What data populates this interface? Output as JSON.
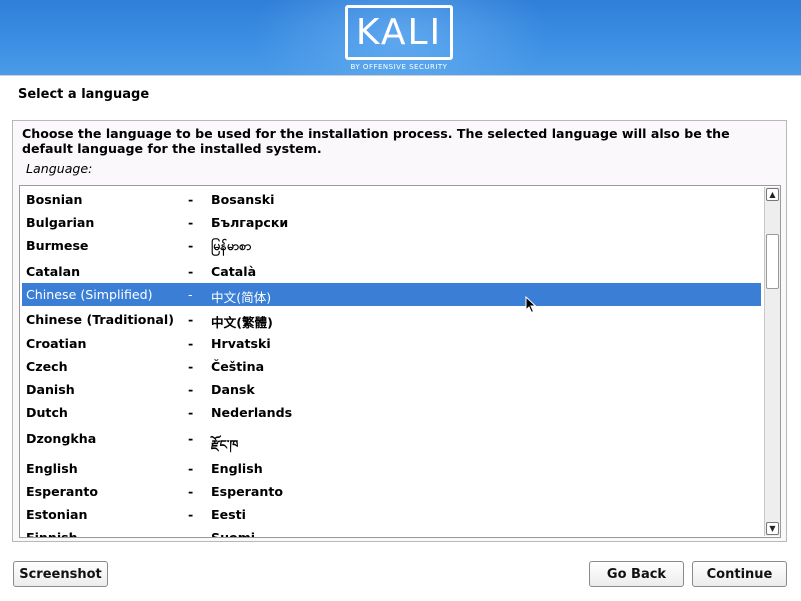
{
  "banner": {
    "logo_text": "KALI",
    "logo_subtitle": "BY OFFENSIVE SECURITY",
    "colors": {
      "top": "#2f7fd8",
      "bottom": "#4a9be8"
    }
  },
  "page": {
    "title": "Select a language",
    "description": "Choose the language to be used for the installation process. The selected language will also be the default language for the installed system.",
    "field_label": "Language:"
  },
  "languages": [
    {
      "name": "Bosnian",
      "dash": "-",
      "native": "Bosanski"
    },
    {
      "name": "Bulgarian",
      "dash": "-",
      "native": "Български"
    },
    {
      "name": "Burmese",
      "dash": "-",
      "native": "မြန်မာစာ"
    },
    {
      "name": "Catalan",
      "dash": "-",
      "native": "Català"
    },
    {
      "name": "Chinese (Simplified)",
      "dash": "-",
      "native": "中文(简体)"
    },
    {
      "name": "Chinese (Traditional)",
      "dash": "-",
      "native": "中文(繁體)"
    },
    {
      "name": "Croatian",
      "dash": "-",
      "native": "Hrvatski"
    },
    {
      "name": "Czech",
      "dash": "-",
      "native": "Čeština"
    },
    {
      "name": "Danish",
      "dash": "-",
      "native": "Dansk"
    },
    {
      "name": "Dutch",
      "dash": "-",
      "native": "Nederlands"
    },
    {
      "name": "Dzongkha",
      "dash": "-",
      "native": "རྫོང་ཁ"
    },
    {
      "name": "English",
      "dash": "-",
      "native": "English"
    },
    {
      "name": "Esperanto",
      "dash": "-",
      "native": "Esperanto"
    },
    {
      "name": "Estonian",
      "dash": "-",
      "native": "Eesti"
    },
    {
      "name": "Finnish",
      "dash": "-",
      "native": "Suomi"
    }
  ],
  "selected_language": "Chinese (Simplified)",
  "scrollbar": {
    "up_icon": "chevron-up-icon",
    "down_icon": "chevron-down-icon"
  },
  "buttons": {
    "screenshot": "Screenshot",
    "go_back": "Go Back",
    "continue": "Continue"
  },
  "accent_colors": {
    "selection": "#3a7fd5"
  }
}
